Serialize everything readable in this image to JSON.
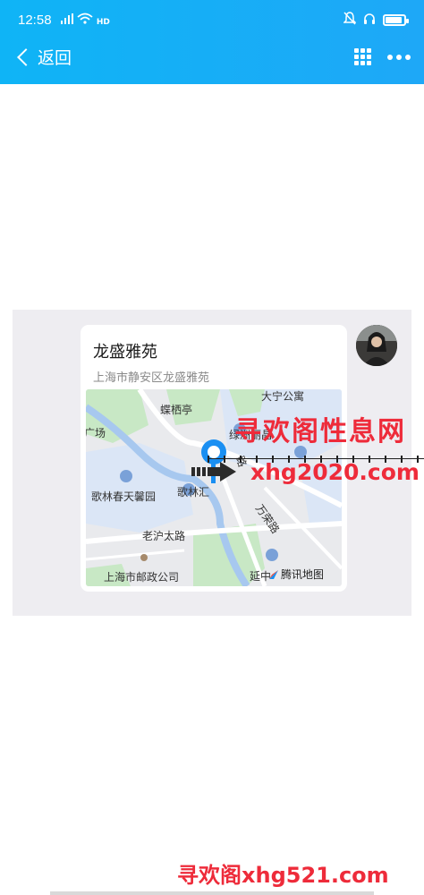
{
  "status_bar": {
    "time": "12:58",
    "wifi_label": "HD"
  },
  "nav": {
    "back_label": "返回"
  },
  "location_card": {
    "title": "龙盛雅苑",
    "address": "上海市静安区龙盛雅苑",
    "map_labels": {
      "label_1": "大宁公寓",
      "label_2": "蝶栖亭",
      "label_3": "广场",
      "label_4": "绿洲丽晶",
      "label_5": "歌林春天馨园",
      "label_6": "歌林汇",
      "label_7": "万荣路",
      "label_8": "老沪太路",
      "label_9": "上海市邮政公司",
      "label_10": "延中",
      "label_11": "路",
      "map_attribution": "腾讯地图"
    }
  },
  "watermarks": {
    "wm1": "寻欢阁性息网",
    "wm2": "xhg2020.com",
    "wm3": "寻欢阁xhg521.com"
  },
  "colors": {
    "header": "#0fb4f6",
    "chat_bg": "#eeedf1",
    "watermark": "#ee2b3a"
  }
}
